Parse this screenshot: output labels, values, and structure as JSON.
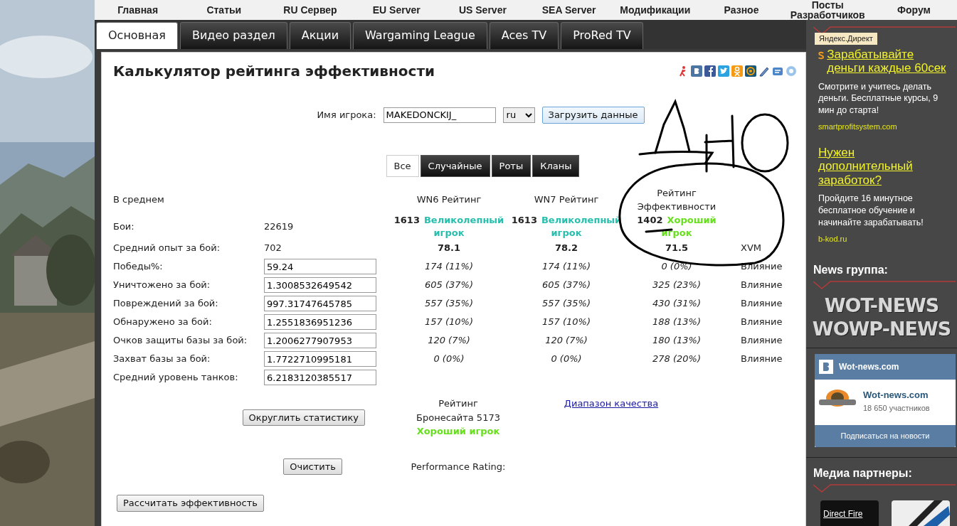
{
  "nav": {
    "items": [
      "Главная",
      "Статьи",
      "RU Сервер",
      "EU Server",
      "US Server",
      "SEA Server",
      "Модификации",
      "Разное",
      "Посты Разработчиков",
      "Форум"
    ]
  },
  "tabs": [
    {
      "label": "Основная",
      "selected": true
    },
    {
      "label": "Видео раздел",
      "selected": false
    },
    {
      "label": "Акции",
      "selected": false
    },
    {
      "label": "Wargaming League",
      "selected": false
    },
    {
      "label": "Aces TV",
      "selected": false
    },
    {
      "label": "ProRed TV",
      "selected": false
    }
  ],
  "calculator": {
    "title": "Калькулятор рейтинга эффективности",
    "player": {
      "label": "Имя игрока:",
      "value": "MAKEDONCKIJ_",
      "region": "ru",
      "load_button": "Загрузить данные"
    },
    "filter_tabs": [
      {
        "label": "Все",
        "selected": true
      },
      {
        "label": "Случайные",
        "selected": false
      },
      {
        "label": "Роты",
        "selected": false
      },
      {
        "label": "Кланы",
        "selected": false
      }
    ],
    "average_label": "В среднем",
    "columns": [
      "WN6 Рейтинг",
      "WN7 Рейтинг",
      "Рейтинг Эффективности"
    ],
    "battles": {
      "label": "Бои:",
      "value": "22619"
    },
    "ratings": [
      {
        "value": "1613",
        "verdict": "Великолепный игрок",
        "color": "#26bfae"
      },
      {
        "value": "1613",
        "verdict": "Великолепный игрок",
        "color": "#26bfae"
      },
      {
        "value": "1402",
        "verdict": "Хороший игрок",
        "color": "#66e01c"
      }
    ],
    "avg_xp": {
      "label": "Средний опыт за бой:",
      "value": "702",
      "scores": [
        "78.1",
        "78.2",
        "71.5"
      ],
      "extra": "XVM"
    },
    "rows": [
      {
        "label": "Победы%:",
        "value": "59.24",
        "cells": [
          "174 (11%)",
          "174 (11%)",
          "0 (0%)"
        ],
        "extra": "Влияние"
      },
      {
        "label": "Уничтожено за бой:",
        "value": "1.3008532649542",
        "cells": [
          "605 (37%)",
          "605 (37%)",
          "325 (23%)"
        ],
        "extra": "Влияние"
      },
      {
        "label": "Повреждений за бой:",
        "value": "997.31747645785",
        "cells": [
          "557 (35%)",
          "557 (35%)",
          "430 (31%)"
        ],
        "extra": "Влияние"
      },
      {
        "label": "Обнаружено за бой:",
        "value": "1.2551836951236",
        "cells": [
          "157 (10%)",
          "157 (10%)",
          "188 (13%)"
        ],
        "extra": "Влияние"
      },
      {
        "label": "Очков защиты базы за бой:",
        "value": "1.2006277907953",
        "cells": [
          "120 (7%)",
          "120 (7%)",
          "180 (13%)"
        ],
        "extra": "Влияние"
      },
      {
        "label": "Захват базы за бой:",
        "value": "1.7722710995181",
        "cells": [
          "0 (0%)",
          "0 (0%)",
          "278 (20%)"
        ],
        "extra": "Влияние"
      },
      {
        "label": "Средний уровень танков:",
        "value": "6.2183120385517"
      }
    ],
    "round_button": "Округлить статистику",
    "armor_rating": "Рейтинг Бронесайта 5173",
    "armor_verdict": {
      "text": "Хороший игрок",
      "color": "#66e01c"
    },
    "quality_link": "Диапазон качества",
    "clear_button": "Очистить",
    "performance_label": "Performance Rating:",
    "calc_button": "Рассчитать эффективность"
  },
  "sidebar": {
    "ad_label": "Яндекс.Директ",
    "ads": [
      {
        "title": "Зарабатывайте деньги каждые 60сек",
        "text": "Смотрите и учитесь делать деньги. Бесплатные курсы, 9 мин до старта!",
        "url": "smartprofitsystem.com",
        "kind": "logo"
      },
      {
        "title": "Нужен дополнительный заработок?",
        "text": "Пройдите 16 минутное бесплатное обучение и начинайте зарабатывать!",
        "url": "b-kod.ru",
        "kind": "plain"
      }
    ],
    "news_heading": "News группа:",
    "banner": [
      "WOT-NEWS",
      "WOWP-NEWS"
    ],
    "vk": {
      "header": "Wot-news.com",
      "name": "Wot-news.com",
      "members": "18 650 участников",
      "subscribe": "Подписаться на новости"
    },
    "media_heading": "Медиа партнеры:",
    "partner": "Direct Fire"
  }
}
